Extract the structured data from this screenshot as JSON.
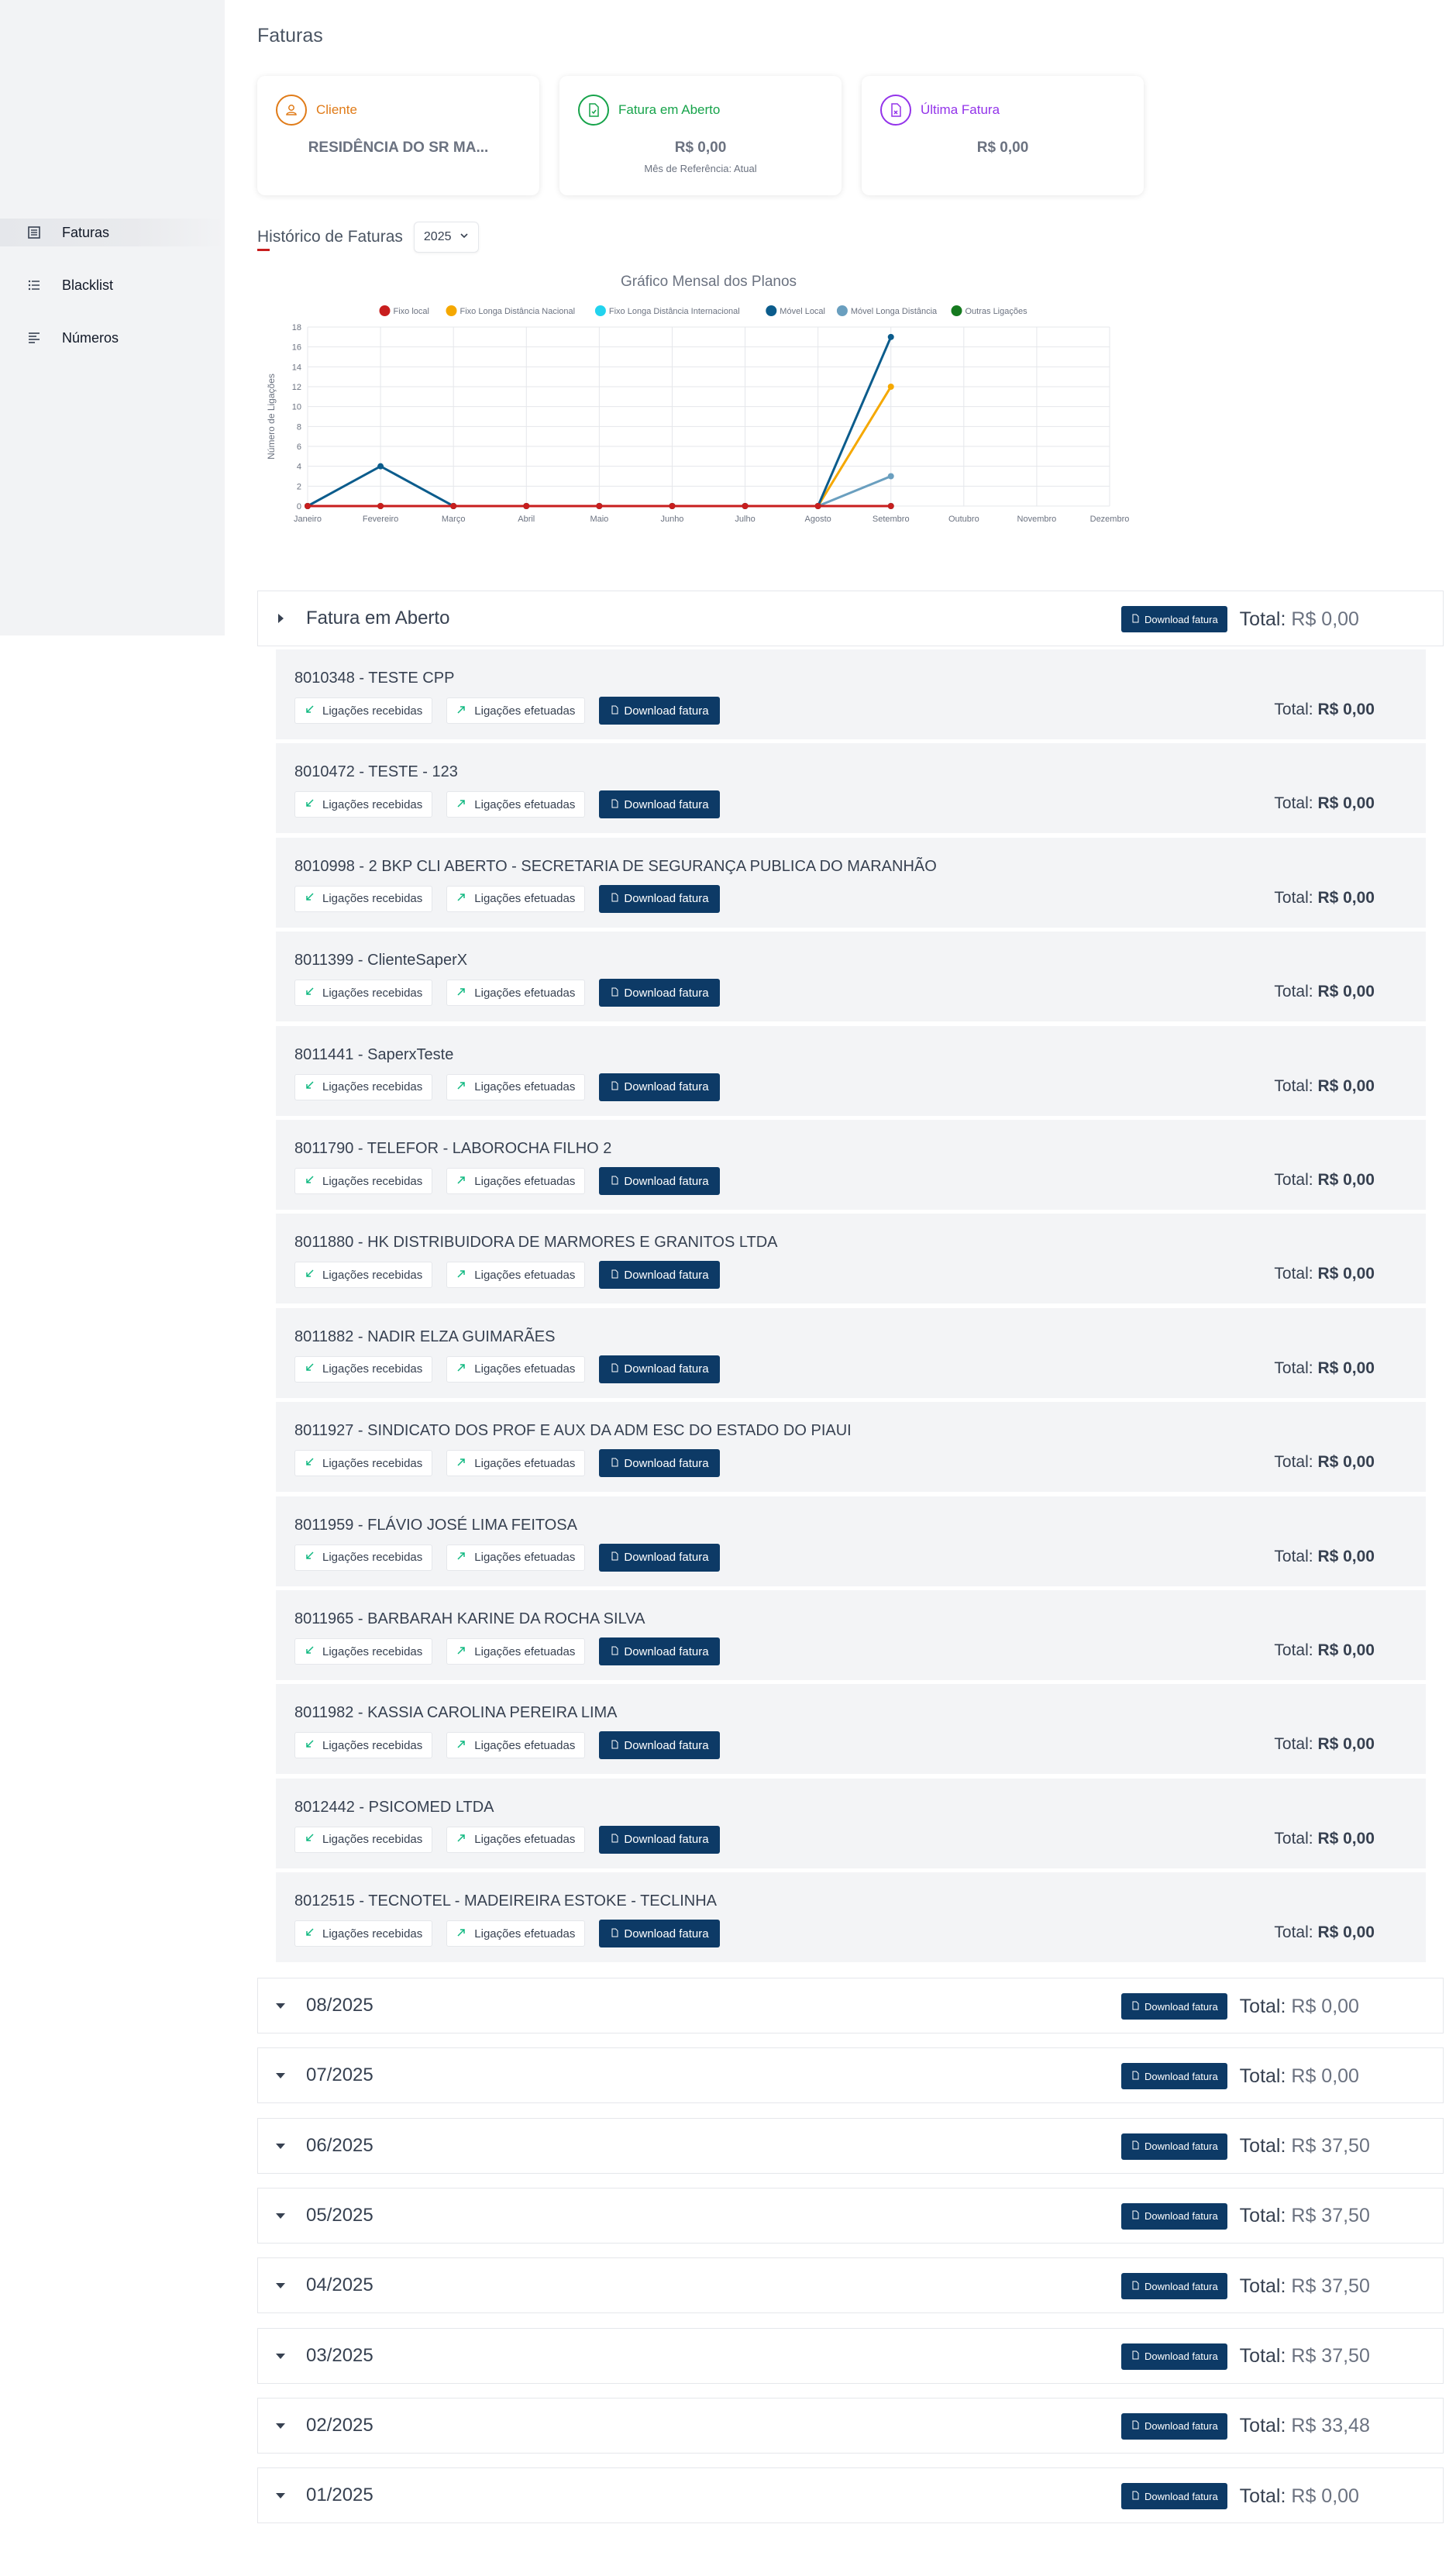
{
  "sidebar": {
    "items": [
      {
        "label": "Faturas",
        "icon": "invoice-icon",
        "active": true
      },
      {
        "label": "Blacklist",
        "icon": "list-icon",
        "active": false
      },
      {
        "label": "Números",
        "icon": "lines-icon",
        "active": false
      }
    ]
  },
  "page": {
    "title": "Faturas"
  },
  "cards": [
    {
      "label": "Cliente",
      "value": "RESIDÊNCIA DO SR MA...",
      "sub": "",
      "color": "#e07b18",
      "icon": "user-icon"
    },
    {
      "label": "Fatura em Aberto",
      "value": "R$ 0,00",
      "sub": "Mês de Referência: Atual",
      "color": "#16a34a",
      "icon": "file-icon"
    },
    {
      "label": "Última Fatura",
      "value": "R$ 0,00",
      "sub": "",
      "color": "#9333ea",
      "icon": "file-icon"
    }
  ],
  "history": {
    "label": "Histórico de Faturas",
    "year": "2025"
  },
  "chart_data": {
    "type": "line",
    "title": "Gráfico Mensal dos Planos",
    "ylabel": "Número de Ligações",
    "xlabel": "",
    "ylim": [
      0,
      18
    ],
    "yticks": [
      0,
      2,
      4,
      6,
      8,
      10,
      12,
      14,
      16,
      18
    ],
    "grid": true,
    "legend": "top",
    "categories": [
      "Janeiro",
      "Fevereiro",
      "Março",
      "Abril",
      "Maio",
      "Junho",
      "Julho",
      "Agosto",
      "Setembro",
      "Outubro",
      "Novembro",
      "Dezembro"
    ],
    "series": [
      {
        "name": "Fixo local",
        "color": "#c81e1e",
        "values": [
          0,
          0,
          0,
          0,
          0,
          0,
          0,
          0,
          0,
          null,
          null,
          null
        ]
      },
      {
        "name": "Fixo Longa Distância Nacional",
        "color": "#f5a800",
        "values": [
          0,
          0,
          0,
          0,
          0,
          0,
          0,
          0,
          12,
          null,
          null,
          null
        ]
      },
      {
        "name": "Fixo Longa Distância Internacional",
        "color": "#22d3ee",
        "values": [
          0,
          0,
          0,
          0,
          0,
          0,
          0,
          0,
          0,
          null,
          null,
          null
        ]
      },
      {
        "name": "Móvel Local",
        "color": "#0b5c8c",
        "values": [
          0,
          4,
          0,
          0,
          0,
          0,
          0,
          0,
          17,
          null,
          null,
          null
        ]
      },
      {
        "name": "Móvel Longa Distância",
        "color": "#6a9fbf",
        "values": [
          0,
          0,
          0,
          0,
          0,
          0,
          0,
          0,
          3,
          null,
          null,
          null
        ]
      },
      {
        "name": "Outras Ligações",
        "color": "#157a1f",
        "values": [
          0,
          0,
          0,
          0,
          0,
          0,
          0,
          0,
          0,
          null,
          null,
          null
        ]
      }
    ]
  },
  "labels": {
    "download": "Download fatura",
    "received": "Ligações recebidas",
    "made": "Ligações efetuadas",
    "total_prefix": "Total:"
  },
  "open_invoice": {
    "title": "Fatura em Aberto",
    "total": "R$ 0,00",
    "items": [
      {
        "title": "8010348 - TESTE CPP",
        "total": "R$ 0,00"
      },
      {
        "title": "8010472 - TESTE - 123",
        "total": "R$ 0,00"
      },
      {
        "title": "8010998 - 2 BKP CLI ABERTO - SECRETARIA DE SEGURANÇA PUBLICA DO MARANHÃO",
        "total": "R$ 0,00"
      },
      {
        "title": "8011399 - ClienteSaperX",
        "total": "R$ 0,00"
      },
      {
        "title": "8011441 - SaperxTeste",
        "total": "R$ 0,00"
      },
      {
        "title": "8011790 - TELEFOR - LABOROCHA FILHO 2",
        "total": "R$ 0,00"
      },
      {
        "title": "8011880 - HK DISTRIBUIDORA DE MARMORES E GRANITOS LTDA",
        "total": "R$ 0,00"
      },
      {
        "title": "8011882 - NADIR ELZA GUIMARÃES",
        "total": "R$ 0,00"
      },
      {
        "title": "8011927 - SINDICATO DOS PROF E AUX DA ADM ESC DO ESTADO DO PIAUI",
        "total": "R$ 0,00"
      },
      {
        "title": "8011959 - FLÁVIO JOSÉ LIMA FEITOSA",
        "total": "R$ 0,00"
      },
      {
        "title": "8011965 - BARBARAH KARINE DA ROCHA SILVA",
        "total": "R$ 0,00"
      },
      {
        "title": "8011982 - KASSIA CAROLINA PEREIRA LIMA",
        "total": "R$ 0,00"
      },
      {
        "title": "8012442 - PSICOMED LTDA",
        "total": "R$ 0,00"
      },
      {
        "title": "8012515 - TECNOTEL - MADEIREIRA ESTOKE - TECLINHA",
        "total": "R$ 0,00"
      }
    ]
  },
  "months": [
    {
      "title": "08/2025",
      "total": "R$ 0,00"
    },
    {
      "title": "07/2025",
      "total": "R$ 0,00"
    },
    {
      "title": "06/2025",
      "total": "R$ 37,50"
    },
    {
      "title": "05/2025",
      "total": "R$ 37,50"
    },
    {
      "title": "04/2025",
      "total": "R$ 37,50"
    },
    {
      "title": "03/2025",
      "total": "R$ 37,50"
    },
    {
      "title": "02/2025",
      "total": "R$ 33,48"
    },
    {
      "title": "01/2025",
      "total": "R$ 0,00"
    }
  ]
}
